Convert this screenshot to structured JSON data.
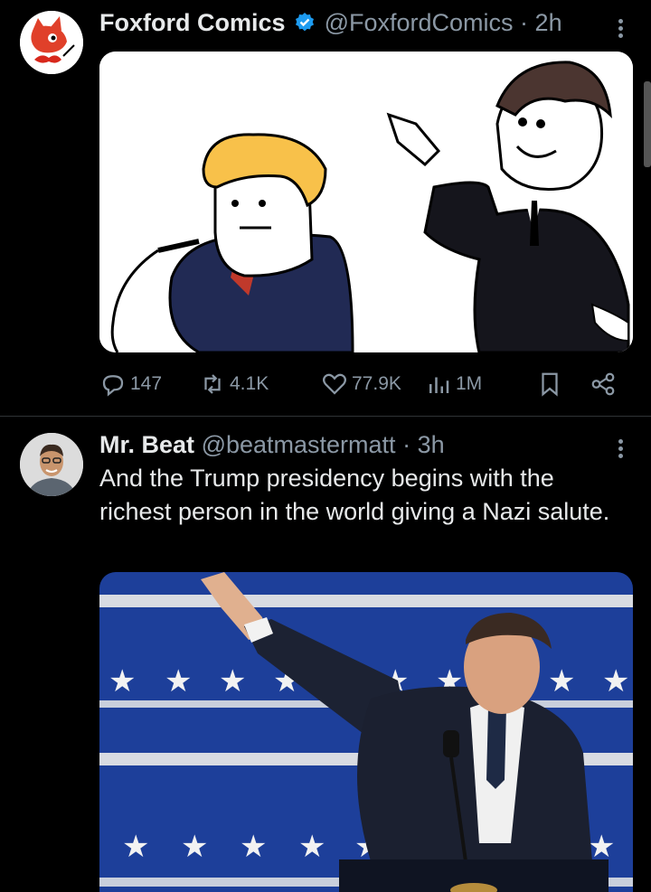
{
  "tweets": [
    {
      "name": "Foxford Comics",
      "verified": true,
      "handle": "@FoxfordComics",
      "sep": "·",
      "time": "2h",
      "stats": {
        "replies": "147",
        "reposts": "4.1K",
        "likes": "77.9K",
        "views": "1M"
      }
    },
    {
      "name": "Mr. Beat",
      "handle": "@beatmastermatt",
      "sep": "·",
      "time": "3h",
      "text": "And the Trump presidency begins with the richest person in the world giving a Nazi salute."
    }
  ],
  "icons": [
    "reply-icon",
    "repost-icon",
    "like-icon",
    "views-icon",
    "bookmark-icon",
    "share-icon",
    "verified-badge-icon",
    "more-icon"
  ],
  "colors": {
    "background": "#000000",
    "text": "#e7e9ea",
    "muted": "#8b98a5",
    "verified": "#1d9bf0"
  }
}
